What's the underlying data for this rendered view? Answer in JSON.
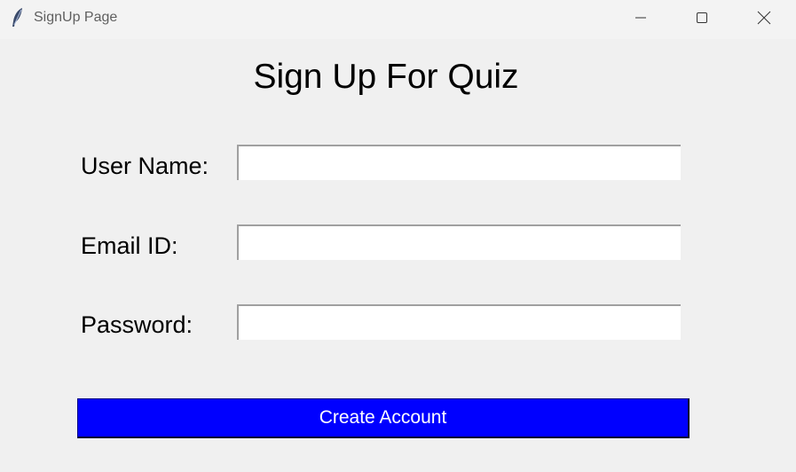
{
  "window": {
    "title": "SignUp Page",
    "controls": {
      "minimize": "minimize-icon",
      "maximize": "maximize-icon",
      "close": "close-icon"
    },
    "app_icon": "feather-icon"
  },
  "form": {
    "heading": "Sign Up For Quiz",
    "fields": [
      {
        "label": "User Name:",
        "value": ""
      },
      {
        "label": "Email ID:",
        "value": ""
      },
      {
        "label": "Password:",
        "value": ""
      }
    ],
    "submit_label": "Create Account"
  },
  "colors": {
    "background": "#f0f0f0",
    "button_bg": "#0000ff",
    "button_text": "#ffffff",
    "input_bg": "#ffffff"
  }
}
